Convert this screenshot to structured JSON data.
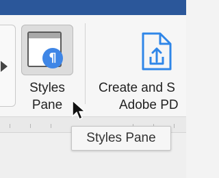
{
  "ribbon": {
    "styles_pane": {
      "label_line1": "Styles",
      "label_line2": "Pane",
      "badge_glyph": "¶",
      "icon": "styles-pane-icon"
    },
    "create_pdf": {
      "label_line1": "Create and S",
      "label_line2": "Adobe PD",
      "icon": "pdf-share-icon"
    }
  },
  "tooltip": {
    "text": "Styles Pane"
  },
  "colors": {
    "title_bar": "#2b579a",
    "badge": "#3f86e6",
    "pdf_icon": "#2f86e8"
  }
}
